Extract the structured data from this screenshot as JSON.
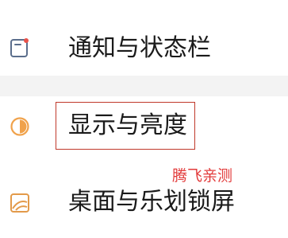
{
  "settings_list": {
    "items": [
      {
        "label": "通知与状态栏",
        "icon": "notification-status-bar-icon"
      },
      {
        "label": "显示与亮度",
        "icon": "display-brightness-icon"
      },
      {
        "label": "桌面与乐划锁屏",
        "icon": "wallpaper-lockscreen-icon"
      }
    ]
  },
  "watermark": {
    "text": "腾飞亲测"
  },
  "colors": {
    "notify_icon": "#5b6e8c",
    "notify_dot": "#e8524a",
    "display_icon": "#f0a24b",
    "desktop_icon": "#e39a4a",
    "highlight_border": "#c0392b",
    "watermark": "#e23a3a"
  }
}
